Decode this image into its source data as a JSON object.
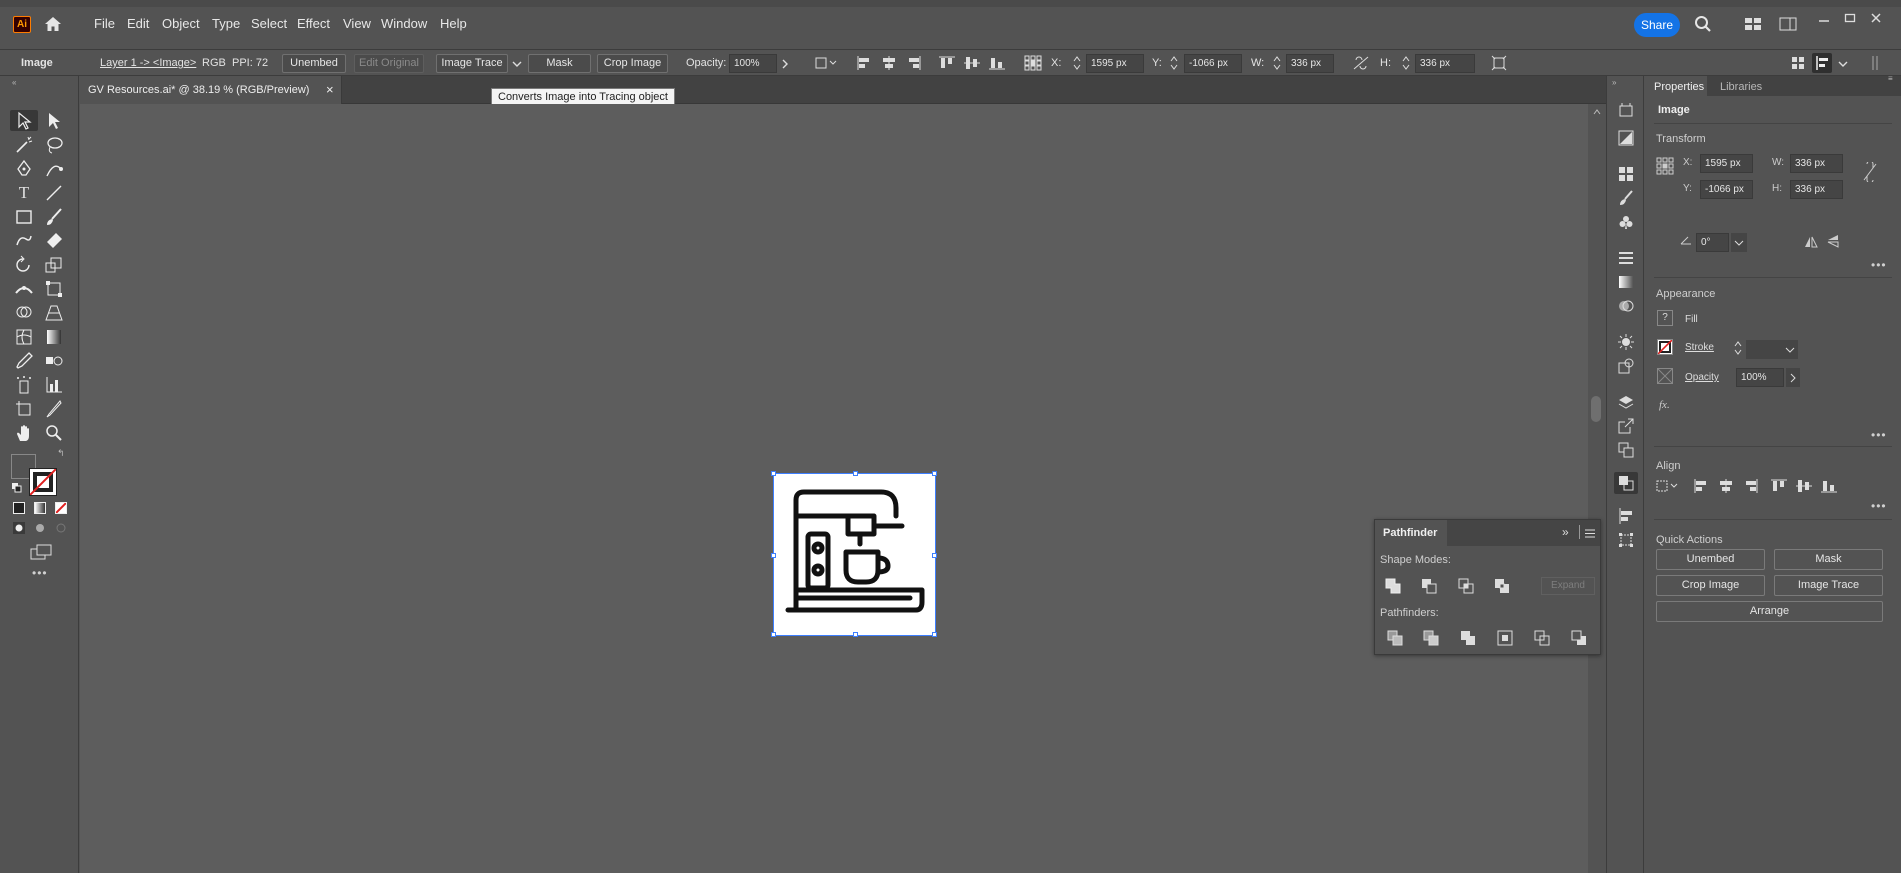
{
  "app": {
    "logo_text": "Ai",
    "accent": "#1473e6"
  },
  "menu": {
    "items": [
      "File",
      "Edit",
      "Object",
      "Type",
      "Select",
      "Effect",
      "View",
      "Window",
      "Help"
    ],
    "share_label": "Share"
  },
  "control": {
    "object_type": "Image",
    "layer_path": "Layer 1 -> <Image>",
    "color_mode": "RGB",
    "ppi": "PPI: 72",
    "unembed": "Unembed",
    "edit_original": "Edit Original",
    "image_trace": "Image Trace",
    "mask": "Mask",
    "crop_image": "Crop Image",
    "opacity_label": "Opacity:",
    "opacity_value": "100%",
    "x_label": "X:",
    "x_value": "1595 px",
    "y_label": "Y:",
    "y_value": "-1066 px",
    "w_label": "W:",
    "w_value": "336 px",
    "h_label": "H:",
    "h_value": "336 px"
  },
  "document": {
    "tab_title": "GV Resources.ai* @ 38.19 % (RGB/Preview)",
    "close": "×"
  },
  "tooltip": "Converts Image into Tracing object",
  "pathfinder": {
    "title": "Pathfinder",
    "shape_modes": "Shape Modes:",
    "expand": "Expand",
    "pathfinders": "Pathfinders:"
  },
  "properties": {
    "tabs": [
      "Properties",
      "Libraries"
    ],
    "selection": "Image",
    "transform": {
      "title": "Transform",
      "x_label": "X:",
      "x": "1595 px",
      "y_label": "Y:",
      "y": "-1066 px",
      "w_label": "W:",
      "w": "336 px",
      "h_label": "H:",
      "h": "336 px",
      "angle": "0°"
    },
    "appearance": {
      "title": "Appearance",
      "fill": "Fill",
      "stroke": "Stroke",
      "opacity": "Opacity",
      "opacity_value": "100%",
      "fx": "fx."
    },
    "align": {
      "title": "Align"
    },
    "quick_actions": {
      "title": "Quick Actions",
      "unembed": "Unembed",
      "mask": "Mask",
      "crop_image": "Crop Image",
      "image_trace": "Image Trace",
      "arrange": "Arrange"
    }
  }
}
